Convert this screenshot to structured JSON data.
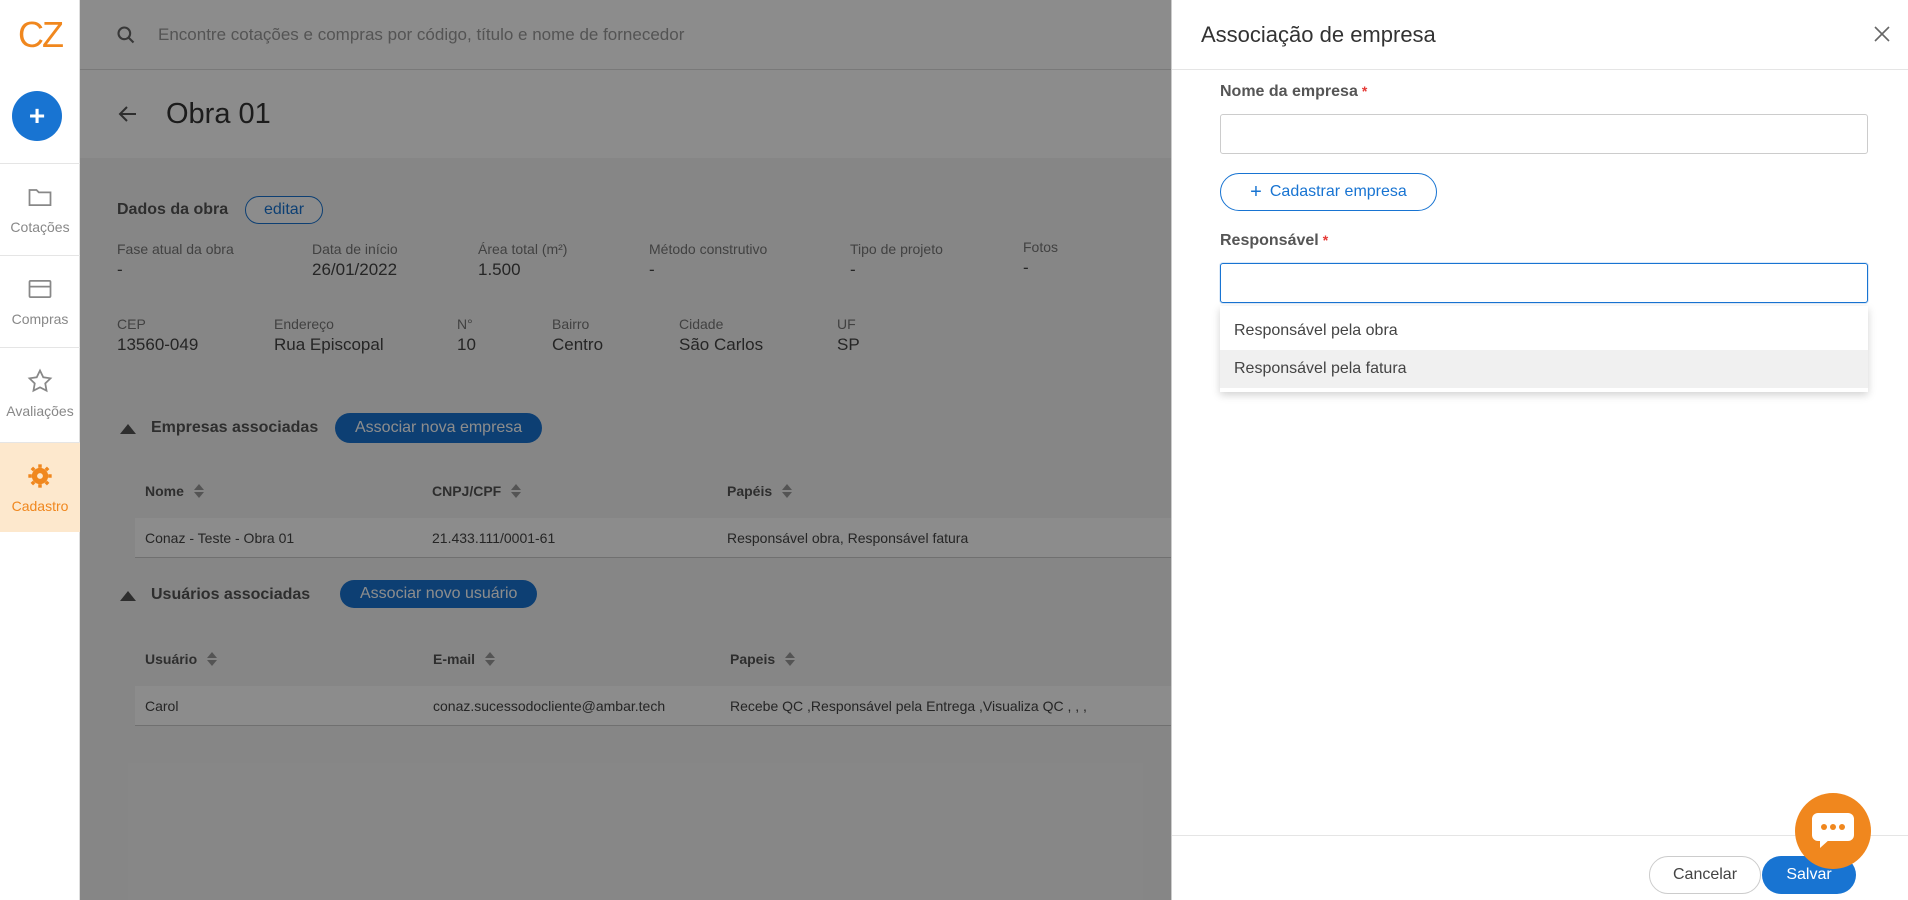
{
  "app": {
    "logo_text": "CZ",
    "accent_color": "#f0871e",
    "brand_blue": "#1874d2"
  },
  "nav": {
    "fab_label": "+",
    "items": [
      {
        "label": "Cotações",
        "icon": "folder-icon"
      },
      {
        "label": "Compras",
        "icon": "card-icon"
      },
      {
        "label": "Avaliações",
        "icon": "star-icon"
      },
      {
        "label": "Cadastro",
        "icon": "gear-icon",
        "active": true
      }
    ]
  },
  "search": {
    "placeholder": "Encontre cotações e compras por código, título e nome de fornecedor"
  },
  "page": {
    "title": "Obra 01"
  },
  "obra": {
    "section_label": "Dados da obra",
    "edit_label": "editar",
    "fields_row1": [
      {
        "label": "Fase atual da obra",
        "value": "-"
      },
      {
        "label": "Data de início",
        "value": "26/01/2022"
      },
      {
        "label": "Área total (m²)",
        "value": "1.500"
      },
      {
        "label": "Método construtivo",
        "value": "-"
      },
      {
        "label": "Tipo de projeto",
        "value": "-"
      },
      {
        "label": "Fotos",
        "value": "-"
      }
    ],
    "fields_row2": [
      {
        "label": "CEP",
        "value": "13560-049"
      },
      {
        "label": "Endereço",
        "value": "Rua Episcopal"
      },
      {
        "label": "N°",
        "value": "10"
      },
      {
        "label": "Bairro",
        "value": "Centro"
      },
      {
        "label": "Cidade",
        "value": "São Carlos"
      },
      {
        "label": "UF",
        "value": "SP"
      }
    ]
  },
  "empresas": {
    "section_label": "Empresas associadas",
    "button_label": "Associar nova empresa",
    "columns": [
      "Nome",
      "CNPJ/CPF",
      "Papéis"
    ],
    "rows": [
      [
        "Conaz - Teste - Obra 01",
        "21.433.111/0001-61",
        "Responsável obra, Responsável fatura"
      ]
    ]
  },
  "usuarios": {
    "section_label": "Usuários associadas",
    "button_label": "Associar novo usuário",
    "columns": [
      "Usuário",
      "E-mail",
      "Papeis"
    ],
    "rows": [
      [
        "Carol",
        "conaz.sucessodocliente@ambar.tech",
        "Recebe QC ,Responsável pela Entrega ,Visualiza QC , , ,"
      ]
    ]
  },
  "drawer": {
    "title": "Associação de empresa",
    "company_label": "Nome da empresa",
    "required_mark": "*",
    "register_button": "Cadastrar empresa",
    "responsible_label": "Responsável",
    "options": [
      "Responsável pela obra",
      "Responsável pela fatura"
    ],
    "cancel_label": "Cancelar",
    "save_label": "Salvar"
  }
}
